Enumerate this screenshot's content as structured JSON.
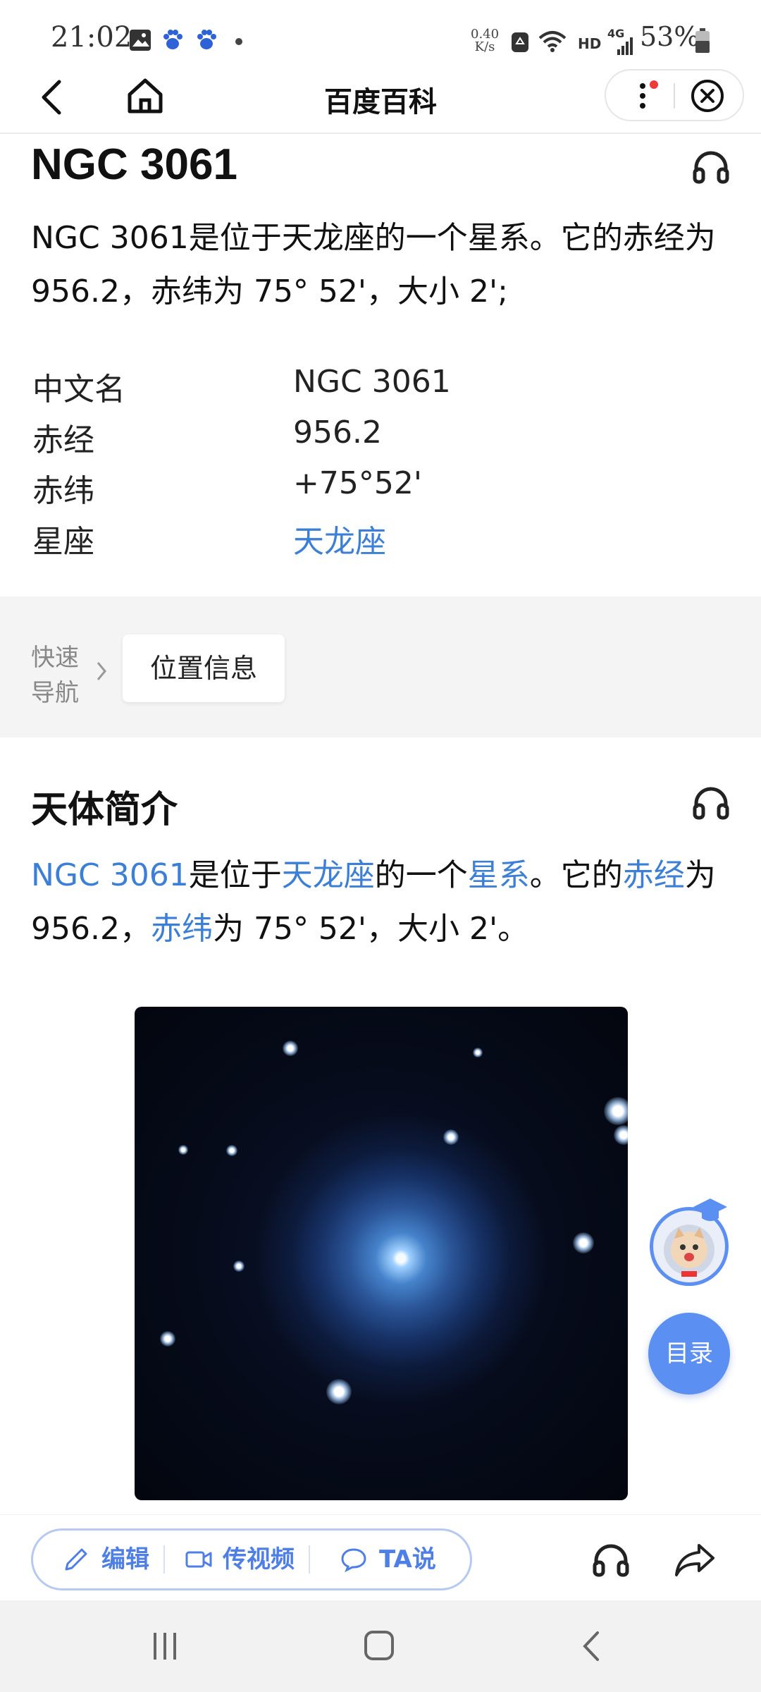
{
  "status_bar": {
    "time": "21:02",
    "net_speed_top": "0.40",
    "net_speed_bottom": "K/s",
    "hd": "HD",
    "network": "4G",
    "battery": "53%"
  },
  "nav": {
    "title": "百度百科"
  },
  "article": {
    "title": "NGC 3061",
    "summary": "NGC 3061是位于天龙座的一个星系。它的赤经为956.2，赤纬为 75° 52'，大小 2';",
    "infobox": [
      {
        "label": "中文名",
        "value": "NGC 3061",
        "link": false
      },
      {
        "label": "赤经",
        "value": "956.2",
        "link": false
      },
      {
        "label": "赤纬",
        "value": "+75°52'",
        "link": false
      },
      {
        "label": "星座",
        "value": "天龙座",
        "link": true
      }
    ]
  },
  "quick_nav": {
    "label_line1": "快速",
    "label_line2": "导航",
    "chip": "位置信息"
  },
  "section": {
    "title": "天体简介",
    "p1_link1": "NGC 3061",
    "p1_t1": "是位于",
    "p1_link2": "天龙座",
    "p1_t2": "的一个",
    "p1_link3": "星系",
    "p1_t3": "。它的",
    "p1_link4": "赤经",
    "p1_t4": "为",
    "p2_t1": "956.2，",
    "p2_link1": "赤纬",
    "p2_t2": "为 75° 52'，大小 2'。"
  },
  "floating": {
    "toc": "目录"
  },
  "actions": {
    "edit": "编辑",
    "video": "传视频",
    "ta": "TA说"
  },
  "colors": {
    "link": "#3c7fd6",
    "accent": "#5b8ff2"
  }
}
